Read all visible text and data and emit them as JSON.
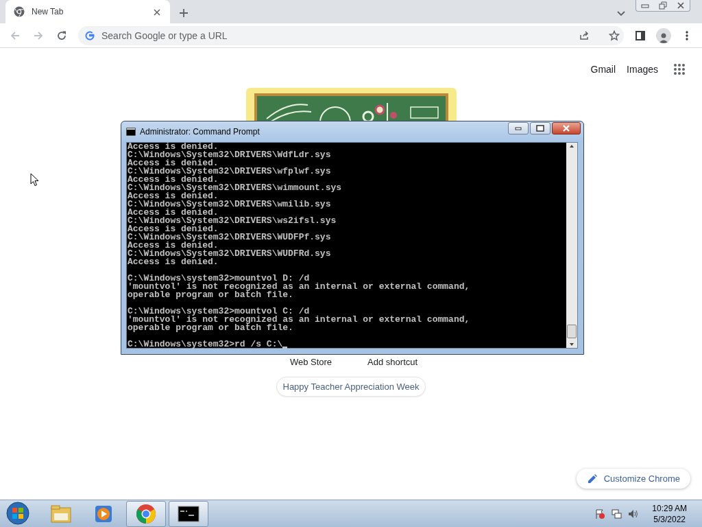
{
  "browser": {
    "tabs": [
      {
        "title": "New Tab",
        "selected": true
      }
    ],
    "omnibox": {
      "placeholder": "Search Google or type a URL"
    }
  },
  "ntp": {
    "header_links": [
      "Gmail",
      "Images"
    ],
    "shortcuts": [
      "Web Store",
      "Add shortcut"
    ],
    "doodle_chip": "Happy Teacher Appreciation Week",
    "customize_button": "Customize Chrome"
  },
  "console": {
    "title": "Administrator: Command Prompt",
    "blocks": [
      [
        "Access is denied.",
        "C:\\Windows\\System32\\DRIVERS\\WdfLdr.sys",
        "Access is denied.",
        "C:\\Windows\\System32\\DRIVERS\\wfplwf.sys",
        "Access is denied.",
        "C:\\Windows\\System32\\DRIVERS\\wimmount.sys",
        "Access is denied.",
        "C:\\Windows\\System32\\DRIVERS\\wmilib.sys",
        "Access is denied.",
        "C:\\Windows\\System32\\DRIVERS\\ws2ifsl.sys",
        "Access is denied.",
        "C:\\Windows\\System32\\DRIVERS\\WUDFPf.sys",
        "Access is denied.",
        "C:\\Windows\\System32\\DRIVERS\\WUDFRd.sys",
        "Access is denied."
      ],
      [
        "C:\\Windows\\system32>mountvol D: /d",
        "'mountvol' is not recognized as an internal or external command,",
        "operable program or batch file."
      ],
      [
        "C:\\Windows\\system32>mountvol C: /d",
        "'mountvol' is not recognized as an internal or external command,",
        "operable program or batch file."
      ],
      [
        "C:\\Windows\\system32>rd /s C:\\"
      ]
    ]
  },
  "taskbar": {
    "apps": [
      {
        "kind": "explorer",
        "running": false
      },
      {
        "kind": "media",
        "running": false
      },
      {
        "kind": "chrome",
        "running": true
      },
      {
        "kind": "console",
        "running": true
      }
    ],
    "clock": {
      "time": "10:29 AM",
      "date": "5/3/2022"
    }
  }
}
